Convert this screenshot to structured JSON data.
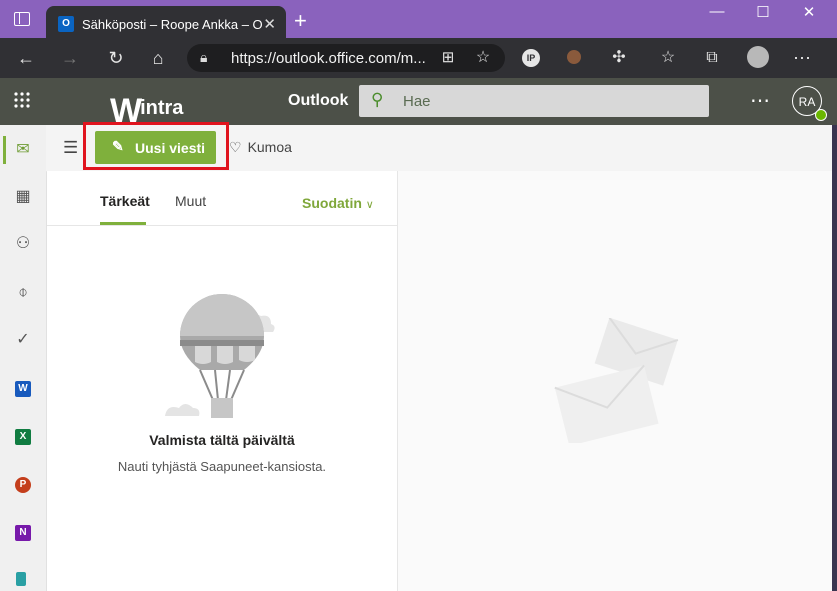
{
  "browser": {
    "tab_title": "Sähköposti – Roope Ankka – Outlook",
    "tab_favicon": "O",
    "new_tab_label": "+",
    "url": "https://outlook.office.com/m..."
  },
  "app": {
    "brand_name": "intra",
    "brand_initial": "W",
    "app_name": "Outlook",
    "search_placeholder": "Hae",
    "avatar_initials": "RA"
  },
  "commands": {
    "new_message": "Uusi viesti",
    "undo": "Kumoa"
  },
  "mail_list": {
    "tab_focused": "Tärkeät",
    "tab_other": "Muut",
    "filter_label": "Suodatin",
    "empty_title": "Valmista tältä päivältä",
    "empty_subtitle": "Nauti tyhjästä Saapuneet-kansiosta."
  },
  "rail_apps": {
    "word": "W",
    "excel": "X",
    "powerpoint": "P",
    "onenote": "N"
  },
  "colors": {
    "accent_green": "#7fb03c",
    "highlight_red": "#e0141e",
    "titlebar_purple": "#8a62bd",
    "appbar": "#4c5048"
  }
}
